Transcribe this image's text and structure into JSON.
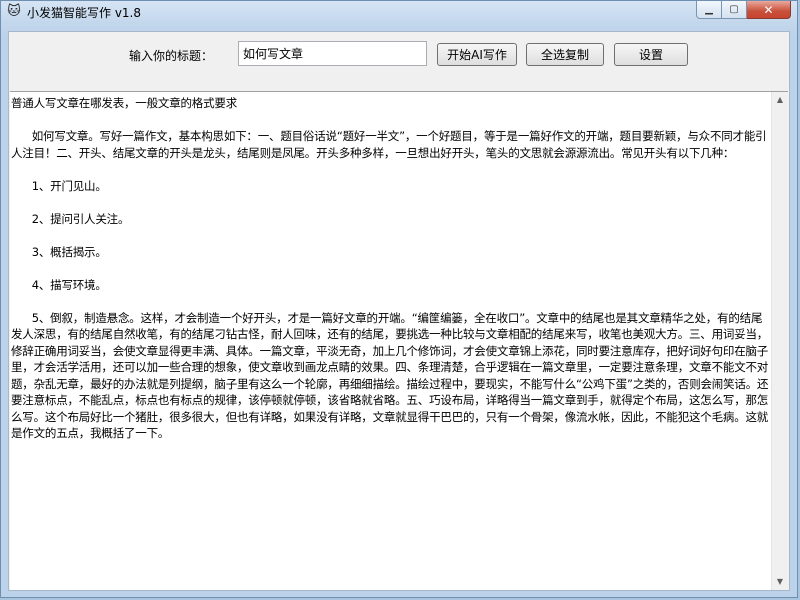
{
  "window": {
    "title": "小发猫智能写作 v1.8",
    "app_icon": "🐱"
  },
  "form": {
    "title_label": "输入你的标题：",
    "title_value": "如何写文章"
  },
  "toolbar": {
    "start_label": "开始AI写作",
    "copy_label": "全选复制",
    "settings_label": "设置"
  },
  "editor": {
    "content": "普通人写文章在哪发表，一般文章的格式要求\n\n      如何写文章。写好一篇作文，基本构思如下：一、题目俗话说“题好一半文”，一个好题目，等于是一篇好作文的开端，题目要新颖，与众不同才能引人注目！二、开头、结尾文章的开头是龙头，结尾则是凤尾。开头多种多样，一旦想出好开头，笔头的文思就会源源流出。常见开头有以下几种：\n\n      1、开门见山。\n\n      2、提问引人关注。\n\n      3、概括揭示。\n\n      4、描写环境。\n\n      5、倒叙，制造悬念。这样，才会制造一个好开头，才是一篇好文章的开端。“编筐编篓，全在收口”。文章中的结尾也是其文章精华之处，有的结尾发人深思，有的结尾自然收笔，有的结尾刁钻古怪，耐人回味，还有的结尾，要挑选一种比较与文章相配的结尾来写，收笔也美观大方。三、用词妥当，修辞正确用词妥当，会使文章显得更丰满、具体。一篇文章，平淡无奇，加上几个修饰词，才会使文章锦上添花，同时要注意库存，把好词好句印在脑子里，才会活学活用，还可以加一些合理的想象，使文章收到画龙点睛的效果。四、条理清楚，合乎逻辑在一篇文章里，一定要注意条理，文章不能文不对题，杂乱无章，最好的办法就是列提纲，脑子里有这么一个轮廓，再细细描绘。描绘过程中，要现实，不能写什么“公鸡下蛋”之类的，否则会闹笑话。还要注意标点，不能乱点，标点也有标点的规律，该停顿就停顿，该省略就省略。五、巧设布局，详略得当一篇文章到手，就得定个布局，这怎么写，那怎么写。这个布局好比一个猪肚，很多很大，但也有详略，如果没有详略，文章就显得干巴巴的，只有一个骨架，像流水帐，因此，不能犯这个毛病。这就是作文的五点，我概括了一下。"
  }
}
